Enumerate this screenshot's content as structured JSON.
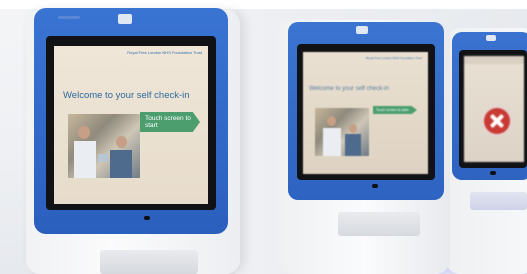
{
  "kiosks": [
    {
      "screen": {
        "header_tag": "Royal Free London NHS Foundation Trust",
        "welcome_text": "Welcome to your self check-in",
        "button_label": "Touch screen to start"
      }
    },
    {
      "screen": {
        "header_tag": "Royal Free London NHS Foundation Trust",
        "welcome_text": "Welcome to your self check-in",
        "button_label": "Touch screen to start"
      }
    },
    {
      "screen": {
        "status_icon": "x-cross-icon"
      }
    }
  ],
  "colors": {
    "bezel_blue": "#2f66c4",
    "screen_cream": "#efe6d8",
    "welcome_blue": "#2f6a9e",
    "button_green": "#4c9e6f",
    "error_red": "#c93a35",
    "glow_blue": "#9aa9ff"
  }
}
